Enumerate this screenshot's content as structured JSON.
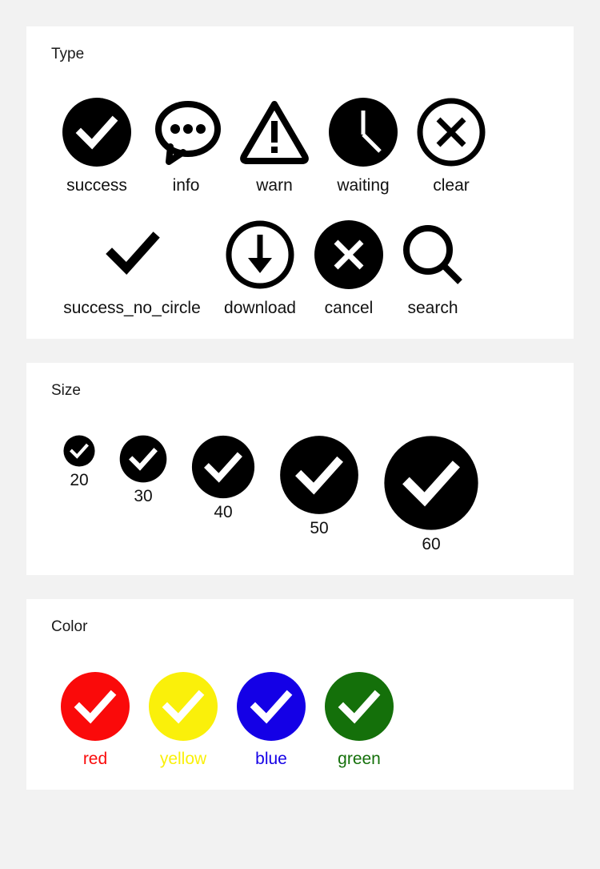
{
  "page": {
    "background_color": "#f2f2f2",
    "card_color": "#ffffff"
  },
  "sections": [
    {
      "key": "type",
      "title": "Type",
      "rows": [
        [
          {
            "label": "success",
            "icon": "success-icon",
            "size": 88
          },
          {
            "label": "info",
            "icon": "info-speech-bubble-icon",
            "size": 88
          },
          {
            "label": "warn",
            "icon": "warn-triangle-icon",
            "size": 88
          },
          {
            "label": "waiting",
            "icon": "waiting-clock-icon",
            "size": 88
          },
          {
            "label": "clear",
            "icon": "clear-circle-x-icon",
            "size": 88
          }
        ],
        [
          {
            "label": "success_no_circle",
            "icon": "check-icon",
            "size": 88
          },
          {
            "label": "download",
            "icon": "download-arrow-icon",
            "size": 88
          },
          {
            "label": "cancel",
            "icon": "cancel-icon",
            "size": 88
          },
          {
            "label": "search",
            "icon": "search-icon",
            "size": 88
          }
        ]
      ]
    },
    {
      "key": "size",
      "title": "Size",
      "items": [
        {
          "label": "20",
          "icon": "success-icon",
          "size": 40
        },
        {
          "label": "30",
          "icon": "success-icon",
          "size": 60
        },
        {
          "label": "40",
          "icon": "success-icon",
          "size": 80
        },
        {
          "label": "50",
          "icon": "success-icon",
          "size": 100
        },
        {
          "label": "60",
          "icon": "success-icon",
          "size": 120
        }
      ]
    },
    {
      "key": "color",
      "title": "Color",
      "items": [
        {
          "label": "red",
          "icon": "success-icon",
          "size": 88,
          "color": "#fa0a0a"
        },
        {
          "label": "yellow",
          "icon": "success-icon",
          "size": 88,
          "color": "#faf00a"
        },
        {
          "label": "blue",
          "icon": "success-icon",
          "size": 88,
          "color": "#1400e6"
        },
        {
          "label": "green",
          "icon": "success-icon",
          "size": 88,
          "color": "#14700a"
        }
      ]
    }
  ],
  "labels": {
    "type_title": "Type",
    "size_title": "Size",
    "color_title": "Color"
  }
}
